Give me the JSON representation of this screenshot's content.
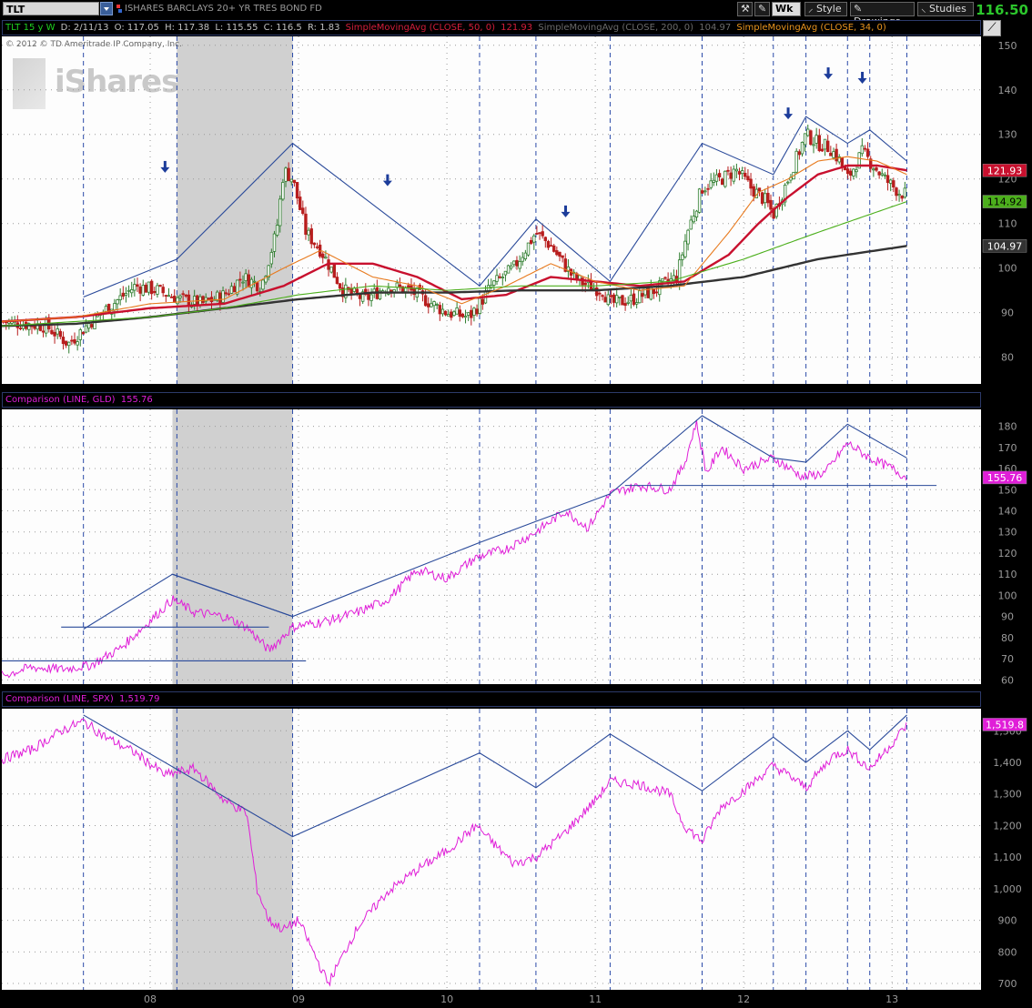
{
  "toolbar": {
    "symbol": "TLT",
    "description": "ISHARES BARCLAYS 20+ YR TRES BOND FD",
    "aggregation": "Wk",
    "style_label": "Style",
    "drawings_label": "Drawings",
    "studies_label": "Studies",
    "last_price": "116.50"
  },
  "colors": {
    "price_up": "#2e7d2e",
    "price_down": "#b81e1e",
    "sma50": "#c8102e",
    "sma200": "#333333",
    "sma34": "#e87a1e",
    "sma_green": "#4caf1c",
    "comparison": "#e01ed8",
    "trendline": "#2a4a9a",
    "shade": "#c8c8c8"
  },
  "panes": {
    "price": {
      "header": {
        "symbol_period": "TLT 15 y W",
        "date": "D: 2/11/13",
        "open": "O: 117.05",
        "high": "H: 117.38",
        "low": "L: 115.55",
        "close": "C: 116.5",
        "range": "R: 1.83",
        "study1": "SimpleMovingAvg (CLOSE, 50, 0)",
        "study1_val": "121.93",
        "study2": "SimpleMovingAvg (CLOSE, 200, 0)",
        "study2_val": "104.97",
        "study3": "SimpleMovingAvg (CLOSE, 34, 0)"
      },
      "copyright": "© 2012 © TD Ameritrade IP Company, Inc.",
      "logo_text": "iShares",
      "value_badges": {
        "sma50": "121.93",
        "green": "114.92",
        "sma200": "104.97"
      }
    },
    "gld": {
      "header_label": "Comparison (LINE, GLD)",
      "header_value": "155.76",
      "badge": "155.76"
    },
    "spx": {
      "header_label": "Comparison (LINE, SPX)",
      "header_value": "1,519.79",
      "badge": "1,519.8"
    }
  },
  "x_axis_labels": [
    "08",
    "09",
    "10",
    "11",
    "12",
    "13"
  ],
  "chart_data": [
    {
      "type": "candlestick",
      "title": "TLT 15 y W",
      "ylim": [
        74,
        152
      ],
      "yticks": [
        80,
        90,
        100,
        110,
        120,
        130,
        140,
        150
      ],
      "x_range": [
        2007.0,
        2013.6
      ],
      "grid": true,
      "shaded_x": [
        2008.18,
        2008.96
      ],
      "vlines_x": [
        2007.55,
        2008.18,
        2008.96,
        2010.22,
        2010.6,
        2011.1,
        2011.72,
        2012.2,
        2012.42,
        2012.7,
        2012.85,
        2013.1
      ],
      "candles_close_anchors": {
        "x": [
          2007.0,
          2007.3,
          2007.45,
          2007.6,
          2007.75,
          2007.9,
          2008.05,
          2008.2,
          2008.35,
          2008.5,
          2008.62,
          2008.75,
          2008.85,
          2008.9,
          2008.96,
          2009.05,
          2009.15,
          2009.3,
          2009.45,
          2009.6,
          2009.75,
          2009.9,
          2010.0,
          2010.15,
          2010.22,
          2010.3,
          2010.45,
          2010.6,
          2010.7,
          2010.85,
          2010.95,
          2011.05,
          2011.1,
          2011.25,
          2011.4,
          2011.55,
          2011.62,
          2011.72,
          2011.85,
          2011.95,
          2012.05,
          2012.15,
          2012.2,
          2012.3,
          2012.42,
          2012.5,
          2012.58,
          2012.65,
          2012.7,
          2012.8,
          2012.85,
          2012.95,
          2013.05,
          2013.1
        ],
        "y": [
          88,
          87,
          83,
          88,
          92,
          96,
          95,
          93,
          92,
          94,
          98,
          96,
          108,
          122,
          120,
          108,
          104,
          95,
          93,
          96,
          95,
          92,
          90,
          89,
          92,
          96,
          100,
          108,
          105,
          98,
          96,
          95,
          92,
          93,
          95,
          98,
          108,
          118,
          120,
          122,
          118,
          115,
          112,
          120,
          130,
          128,
          127,
          124,
          120,
          126,
          124,
          120,
          117,
          116.5
        ]
      },
      "series": [
        {
          "name": "SimpleMovingAvg (CLOSE, 50, 0)",
          "x": [
            2007.0,
            2007.5,
            2008.0,
            2008.5,
            2008.9,
            2009.2,
            2009.5,
            2009.8,
            2010.1,
            2010.4,
            2010.7,
            2011.0,
            2011.3,
            2011.6,
            2011.9,
            2012.1,
            2012.3,
            2012.5,
            2012.7,
            2012.9,
            2013.1
          ],
          "y": [
            88,
            89,
            91,
            92,
            96,
            101,
            101,
            98,
            93,
            94,
            98,
            97,
            96,
            97,
            103,
            110,
            116,
            121,
            123,
            123,
            121.93
          ]
        },
        {
          "name": "SimpleMovingAvg (CLOSE, 200, 0)",
          "x": [
            2007.0,
            2007.5,
            2008.0,
            2008.5,
            2009.0,
            2009.5,
            2010.0,
            2010.5,
            2011.0,
            2011.5,
            2012.0,
            2012.5,
            2013.1
          ],
          "y": [
            87,
            87.5,
            89,
            91,
            93,
            94.5,
            94.5,
            95,
            95,
            96,
            98,
            102,
            104.97
          ]
        },
        {
          "name": "SimpleMovingAvg (CLOSE, 34, 0)",
          "x": [
            2007.0,
            2007.5,
            2008.0,
            2008.5,
            2008.9,
            2009.15,
            2009.5,
            2009.8,
            2010.1,
            2010.4,
            2010.7,
            2011.0,
            2011.3,
            2011.6,
            2011.9,
            2012.1,
            2012.3,
            2012.5,
            2012.7,
            2012.9,
            2013.1
          ],
          "y": [
            88,
            89,
            92,
            93,
            100,
            104,
            98,
            96,
            92,
            96,
            101,
            97,
            95,
            96,
            108,
            117,
            120,
            124,
            125,
            124,
            121
          ]
        },
        {
          "x": [
            2007.0,
            2007.5,
            2008.0,
            2008.5,
            2009.0,
            2009.5,
            2010.0,
            2010.5,
            2011.0,
            2011.5,
            2012.0,
            2012.5,
            2013.1
          ],
          "y": [
            87,
            88,
            89,
            91,
            94,
            96,
            95,
            96,
            96,
            97,
            102,
            108,
            114.92
          ]
        }
      ],
      "trendlines": [
        {
          "x": [
            2007.55,
            2008.18,
            2008.96,
            2010.22,
            2010.6,
            2011.1,
            2011.72,
            2012.2,
            2012.42,
            2012.7,
            2012.85,
            2013.1
          ],
          "y": [
            93.5,
            102,
            128,
            96,
            111,
            97,
            128,
            121,
            134,
            128,
            131,
            124
          ]
        }
      ],
      "markers": {
        "type": "down-arrow",
        "x": [
          2008.1,
          2009.6,
          2010.8,
          2012.3,
          2012.57,
          2012.8
        ],
        "y": [
          122,
          119,
          112,
          134,
          143,
          142
        ]
      }
    },
    {
      "type": "line",
      "title": "Comparison (LINE, GLD)",
      "ylim": [
        58,
        188
      ],
      "yticks": [
        60,
        70,
        80,
        90,
        100,
        110,
        120,
        130,
        140,
        150,
        160,
        170,
        180
      ],
      "shaded_x": [
        2008.15,
        2008.96
      ],
      "series": [
        {
          "name": "GLD",
          "x": [
            2007.0,
            2007.2,
            2007.4,
            2007.6,
            2007.8,
            2008.0,
            2008.15,
            2008.3,
            2008.5,
            2008.65,
            2008.8,
            2008.96,
            2009.2,
            2009.4,
            2009.6,
            2009.8,
            2010.0,
            2010.2,
            2010.4,
            2010.6,
            2010.8,
            2010.95,
            2011.1,
            2011.3,
            2011.5,
            2011.6,
            2011.68,
            2011.75,
            2011.85,
            2012.0,
            2012.2,
            2012.4,
            2012.55,
            2012.7,
            2012.85,
            2013.0,
            2013.1
          ],
          "y": [
            62,
            66,
            65,
            67,
            75,
            88,
            98,
            92,
            90,
            85,
            74,
            85,
            88,
            92,
            98,
            112,
            108,
            118,
            122,
            130,
            140,
            132,
            148,
            152,
            150,
            162,
            182,
            158,
            170,
            160,
            165,
            156,
            158,
            172,
            165,
            160,
            155.76
          ]
        }
      ],
      "trendlines": [
        {
          "x": [
            2007.55,
            2008.15,
            2008.96,
            2010.22,
            2010.6,
            2011.1,
            2011.72,
            2012.2,
            2012.42,
            2012.7,
            2013.1
          ],
          "y": [
            84,
            110,
            90,
            125,
            135,
            148,
            185,
            165,
            163,
            181,
            165
          ]
        },
        {
          "x": [
            2008.15,
            2008.96
          ],
          "y": [
            110,
            90
          ]
        },
        {
          "x": [
            2007.0,
            2009.05
          ],
          "y": [
            69,
            69
          ]
        },
        {
          "x": [
            2007.4,
            2008.8
          ],
          "y": [
            85,
            85
          ]
        },
        {
          "x": [
            2011.2,
            2013.3
          ],
          "y": [
            152,
            152
          ]
        }
      ]
    },
    {
      "type": "line",
      "title": "Comparison (LINE, SPX)",
      "ylim": [
        680,
        1570
      ],
      "yticks": [
        700,
        800,
        900,
        1000,
        1100,
        1200,
        1300,
        1400,
        1500
      ],
      "shaded_x": [
        2008.15,
        2008.96
      ],
      "series": [
        {
          "name": "SPX",
          "x": [
            2007.0,
            2007.2,
            2007.4,
            2007.55,
            2007.7,
            2007.9,
            2008.1,
            2008.3,
            2008.5,
            2008.65,
            2008.72,
            2008.8,
            2008.9,
            2009.0,
            2009.1,
            2009.2,
            2009.4,
            2009.6,
            2009.8,
            2010.0,
            2010.2,
            2010.3,
            2010.45,
            2010.6,
            2010.8,
            2011.0,
            2011.1,
            2011.3,
            2011.5,
            2011.6,
            2011.72,
            2011.85,
            2012.0,
            2012.2,
            2012.3,
            2012.42,
            2012.6,
            2012.7,
            2012.85,
            2013.0,
            2013.1
          ],
          "y": [
            1410,
            1440,
            1500,
            1530,
            1480,
            1430,
            1360,
            1380,
            1280,
            1240,
            1000,
            900,
            870,
            900,
            800,
            700,
            880,
            990,
            1060,
            1120,
            1200,
            1150,
            1080,
            1100,
            1180,
            1280,
            1340,
            1330,
            1300,
            1200,
            1150,
            1260,
            1310,
            1390,
            1360,
            1320,
            1420,
            1440,
            1380,
            1460,
            1519.79
          ]
        }
      ],
      "trendlines": [
        {
          "x": [
            2007.55,
            2008.96,
            2010.22,
            2010.6,
            2011.1,
            2011.72,
            2012.2,
            2012.42,
            2012.7,
            2012.85,
            2013.1
          ],
          "y": [
            1550,
            1165,
            1430,
            1320,
            1490,
            1310,
            1480,
            1400,
            1500,
            1440,
            1550
          ]
        }
      ]
    }
  ]
}
